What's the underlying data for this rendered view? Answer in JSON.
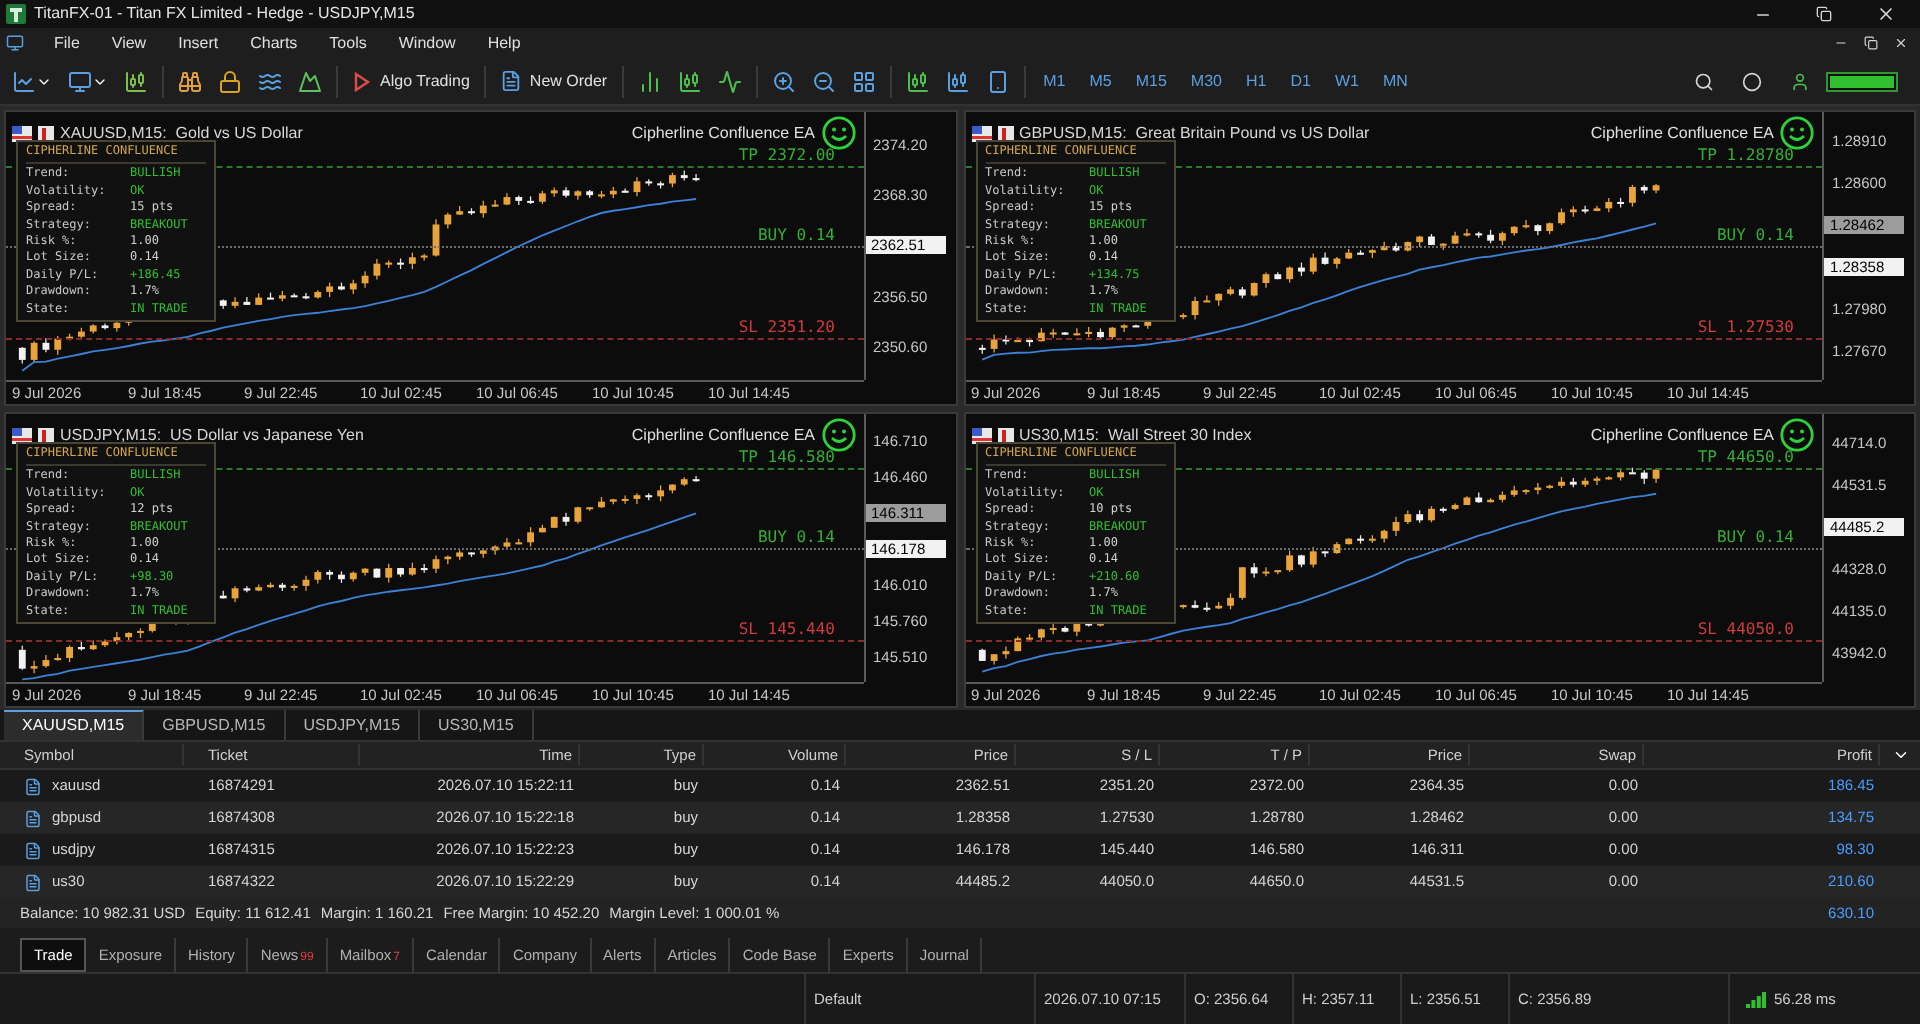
{
  "window": {
    "title": "TitanFX-01 - Titan FX Limited - Hedge - USDJPY,M15"
  },
  "menu": [
    "File",
    "View",
    "Insert",
    "Charts",
    "Tools",
    "Window",
    "Help"
  ],
  "toolbar": {
    "algo_trading": "Algo Trading",
    "new_order": "New Order",
    "timeframes": [
      "M1",
      "M5",
      "M15",
      "M30",
      "H1",
      "D1",
      "W1",
      "MN"
    ]
  },
  "charts": [
    {
      "title": "XAUUSD,M15:  Gold vs US Dollar",
      "ea": "Cipherline Confluence EA",
      "panel": {
        "title": "CIPHERLINE CONFLUENCE",
        "rows": [
          {
            "label": "Trend:",
            "value": "BULLISH",
            "color": "#2fbf2f"
          },
          {
            "label": "Volatility:",
            "value": "OK",
            "color": "#2fbf2f"
          },
          {
            "label": "Spread:",
            "value": "15 pts",
            "color": "#d0d0d0"
          },
          {
            "label": "Strategy:",
            "value": "BREAKOUT",
            "color": "#2fbf2f"
          },
          {
            "label": "Risk %:",
            "value": "1.00",
            "color": "#d0d0d0"
          },
          {
            "label": "Lot Size:",
            "value": "0.14",
            "color": "#d0d0d0"
          },
          {
            "label": "Daily P/L:",
            "value": "+186.45",
            "color": "#2fbf2f"
          },
          {
            "label": "Drawdown:",
            "value": "1.7%",
            "color": "#d0d0d0"
          },
          {
            "label": "State:",
            "value": "IN TRADE",
            "color": "#2fbf2f"
          }
        ]
      },
      "levels": [
        {
          "kind": "tp",
          "label": "TP 2372.00"
        },
        {
          "kind": "entry",
          "label": "BUY 0.14"
        },
        {
          "kind": "sl",
          "label": "SL 2351.20"
        }
      ],
      "price_axis": [
        {
          "kind": "tick",
          "text": "2374.20"
        },
        {
          "kind": "tick",
          "text": "2368.30"
        },
        {
          "kind": "ask",
          "text": "2362.51"
        },
        {
          "kind": "tick",
          "text": "2356.50"
        },
        {
          "kind": "tick",
          "text": "2350.60"
        }
      ],
      "time_axis": [
        "9 Jul 2026",
        "9 Jul 18:45",
        "9 Jul 22:45",
        "10 Jul 02:45",
        "10 Jul 06:45",
        "10 Jul 10:45",
        "10 Jul 14:45"
      ]
    },
    {
      "title": "GBPUSD,M15:  Great Britain Pound vs US Dollar",
      "ea": "Cipherline Confluence EA",
      "panel": {
        "title": "CIPHERLINE CONFLUENCE",
        "rows": [
          {
            "label": "Trend:",
            "value": "BULLISH",
            "color": "#2fbf2f"
          },
          {
            "label": "Volatility:",
            "value": "OK",
            "color": "#2fbf2f"
          },
          {
            "label": "Spread:",
            "value": "15 pts",
            "color": "#d0d0d0"
          },
          {
            "label": "Strategy:",
            "value": "BREAKOUT",
            "color": "#2fbf2f"
          },
          {
            "label": "Risk %:",
            "value": "1.00",
            "color": "#d0d0d0"
          },
          {
            "label": "Lot Size:",
            "value": "0.14",
            "color": "#d0d0d0"
          },
          {
            "label": "Daily P/L:",
            "value": "+134.75",
            "color": "#2fbf2f"
          },
          {
            "label": "Drawdown:",
            "value": "1.7%",
            "color": "#d0d0d0"
          },
          {
            "label": "State:",
            "value": "IN TRADE",
            "color": "#2fbf2f"
          }
        ]
      },
      "levels": [
        {
          "kind": "tp",
          "label": "TP 1.28780"
        },
        {
          "kind": "entry",
          "label": "BUY 0.14"
        },
        {
          "kind": "sl",
          "label": "SL 1.27530"
        }
      ],
      "price_axis": [
        {
          "kind": "tick",
          "text": "1.28910"
        },
        {
          "kind": "tick",
          "text": "1.28600"
        },
        {
          "kind": "bid",
          "text": "1.28462"
        },
        {
          "kind": "ask",
          "text": "1.28358"
        },
        {
          "kind": "tick",
          "text": "1.27980"
        },
        {
          "kind": "tick",
          "text": "1.27670"
        }
      ],
      "time_axis": [
        "9 Jul 2026",
        "9 Jul 18:45",
        "9 Jul 22:45",
        "10 Jul 02:45",
        "10 Jul 06:45",
        "10 Jul 10:45",
        "10 Jul 14:45"
      ]
    },
    {
      "title": "USDJPY,M15:  US Dollar vs Japanese Yen",
      "ea": "Cipherline Confluence EA",
      "panel": {
        "title": "CIPHERLINE CONFLUENCE",
        "rows": [
          {
            "label": "Trend:",
            "value": "BULLISH",
            "color": "#2fbf2f"
          },
          {
            "label": "Volatility:",
            "value": "OK",
            "color": "#2fbf2f"
          },
          {
            "label": "Spread:",
            "value": "12 pts",
            "color": "#d0d0d0"
          },
          {
            "label": "Strategy:",
            "value": "BREAKOUT",
            "color": "#2fbf2f"
          },
          {
            "label": "Risk %:",
            "value": "1.00",
            "color": "#d0d0d0"
          },
          {
            "label": "Lot Size:",
            "value": "0.14",
            "color": "#d0d0d0"
          },
          {
            "label": "Daily P/L:",
            "value": "+98.30",
            "color": "#2fbf2f"
          },
          {
            "label": "Drawdown:",
            "value": "1.7%",
            "color": "#d0d0d0"
          },
          {
            "label": "State:",
            "value": "IN TRADE",
            "color": "#2fbf2f"
          }
        ]
      },
      "levels": [
        {
          "kind": "tp",
          "label": "TP 146.580"
        },
        {
          "kind": "entry",
          "label": "BUY 0.14"
        },
        {
          "kind": "sl",
          "label": "SL 145.440"
        }
      ],
      "price_axis": [
        {
          "kind": "tick",
          "text": "146.710"
        },
        {
          "kind": "tick",
          "text": "146.460"
        },
        {
          "kind": "bid",
          "text": "146.311"
        },
        {
          "kind": "ask",
          "text": "146.178"
        },
        {
          "kind": "tick",
          "text": "146.010"
        },
        {
          "kind": "tick",
          "text": "145.760"
        },
        {
          "kind": "tick",
          "text": "145.510"
        }
      ],
      "time_axis": [
        "9 Jul 2026",
        "9 Jul 18:45",
        "9 Jul 22:45",
        "10 Jul 02:45",
        "10 Jul 06:45",
        "10 Jul 10:45",
        "10 Jul 14:45"
      ]
    },
    {
      "title": "US30,M15:  Wall Street 30 Index",
      "ea": "Cipherline Confluence EA",
      "panel": {
        "title": "CIPHERLINE CONFLUENCE",
        "rows": [
          {
            "label": "Trend:",
            "value": "BULLISH",
            "color": "#2fbf2f"
          },
          {
            "label": "Volatility:",
            "value": "OK",
            "color": "#2fbf2f"
          },
          {
            "label": "Spread:",
            "value": "10 pts",
            "color": "#d0d0d0"
          },
          {
            "label": "Strategy:",
            "value": "BREAKOUT",
            "color": "#2fbf2f"
          },
          {
            "label": "Risk %:",
            "value": "1.00",
            "color": "#d0d0d0"
          },
          {
            "label": "Lot Size:",
            "value": "0.14",
            "color": "#d0d0d0"
          },
          {
            "label": "Daily P/L:",
            "value": "+210.60",
            "color": "#2fbf2f"
          },
          {
            "label": "Drawdown:",
            "value": "1.7%",
            "color": "#d0d0d0"
          },
          {
            "label": "State:",
            "value": "IN TRADE",
            "color": "#2fbf2f"
          }
        ]
      },
      "levels": [
        {
          "kind": "tp",
          "label": "TP 44650.0"
        },
        {
          "kind": "entry",
          "label": "BUY 0.14"
        },
        {
          "kind": "sl",
          "label": "SL 44050.0"
        }
      ],
      "price_axis": [
        {
          "kind": "tick",
          "text": "44714.0"
        },
        {
          "kind": "tick",
          "text": "44531.5"
        },
        {
          "kind": "ask",
          "text": "44485.2"
        },
        {
          "kind": "tick",
          "text": "44328.0"
        },
        {
          "kind": "tick",
          "text": "44135.0"
        },
        {
          "kind": "tick",
          "text": "43942.0"
        }
      ],
      "time_axis": [
        "9 Jul 2026",
        "9 Jul 18:45",
        "9 Jul 22:45",
        "10 Jul 02:45",
        "10 Jul 06:45",
        "10 Jul 10:45",
        "10 Jul 14:45"
      ]
    }
  ],
  "chart_tabs": [
    {
      "label": "XAUUSD,M15",
      "selected": true
    },
    {
      "label": "GBPUSD,M15",
      "selected": false
    },
    {
      "label": "USDJPY,M15",
      "selected": false
    },
    {
      "label": "US30,M15",
      "selected": false
    }
  ],
  "table": {
    "columns": [
      "Symbol",
      "Ticket",
      "Time",
      "Type",
      "Volume",
      "Price",
      "S / L",
      "T / P",
      "Price",
      "Swap",
      "Profit"
    ],
    "rows": [
      [
        "xauusd",
        "16874291",
        "2026.07.10 15:22:11",
        "buy",
        "0.14",
        "2362.51",
        "2351.20",
        "2372.00",
        "2364.35",
        "0.00",
        "186.45"
      ],
      [
        "gbpusd",
        "16874308",
        "2026.07.10 15:22:18",
        "buy",
        "0.14",
        "1.28358",
        "1.27530",
        "1.28780",
        "1.28462",
        "0.00",
        "134.75"
      ],
      [
        "usdjpy",
        "16874315",
        "2026.07.10 15:22:23",
        "buy",
        "0.14",
        "146.178",
        "145.440",
        "146.580",
        "146.311",
        "0.00",
        "98.30"
      ],
      [
        "us30",
        "16874322",
        "2026.07.10 15:22:29",
        "buy",
        "0.14",
        "44485.2",
        "44050.0",
        "44650.0",
        "44531.5",
        "0.00",
        "210.60"
      ]
    ],
    "summary": [
      "Balance: 10 982.31 USD",
      "Equity: 11 612.41",
      "Margin: 1 160.21",
      "Free Margin: 10 452.20",
      "Margin Level: 1 000.01 %"
    ],
    "total_profit": "630.10"
  },
  "bottom_tabs": [
    {
      "label": "Trade",
      "selected": true
    },
    {
      "label": "Exposure",
      "selected": false
    },
    {
      "label": "History",
      "selected": false
    },
    {
      "label": "News",
      "badge": "99",
      "selected": false
    },
    {
      "label": "Mailbox",
      "badge": "7",
      "selected": false
    },
    {
      "label": "Calendar",
      "selected": false
    },
    {
      "label": "Company",
      "selected": false
    },
    {
      "label": "Alerts",
      "selected": false
    },
    {
      "label": "Articles",
      "selected": false
    },
    {
      "label": "Code Base",
      "selected": false
    },
    {
      "label": "Experts",
      "selected": false
    },
    {
      "label": "Journal",
      "selected": false
    }
  ],
  "status_bar": {
    "profile": "Default",
    "time": "2026.07.10 07:15",
    "open": "O: 2356.64",
    "high": "H: 2357.11",
    "low": "L: 2356.51",
    "close": "C: 2356.89",
    "ping": "56.28 ms"
  }
}
